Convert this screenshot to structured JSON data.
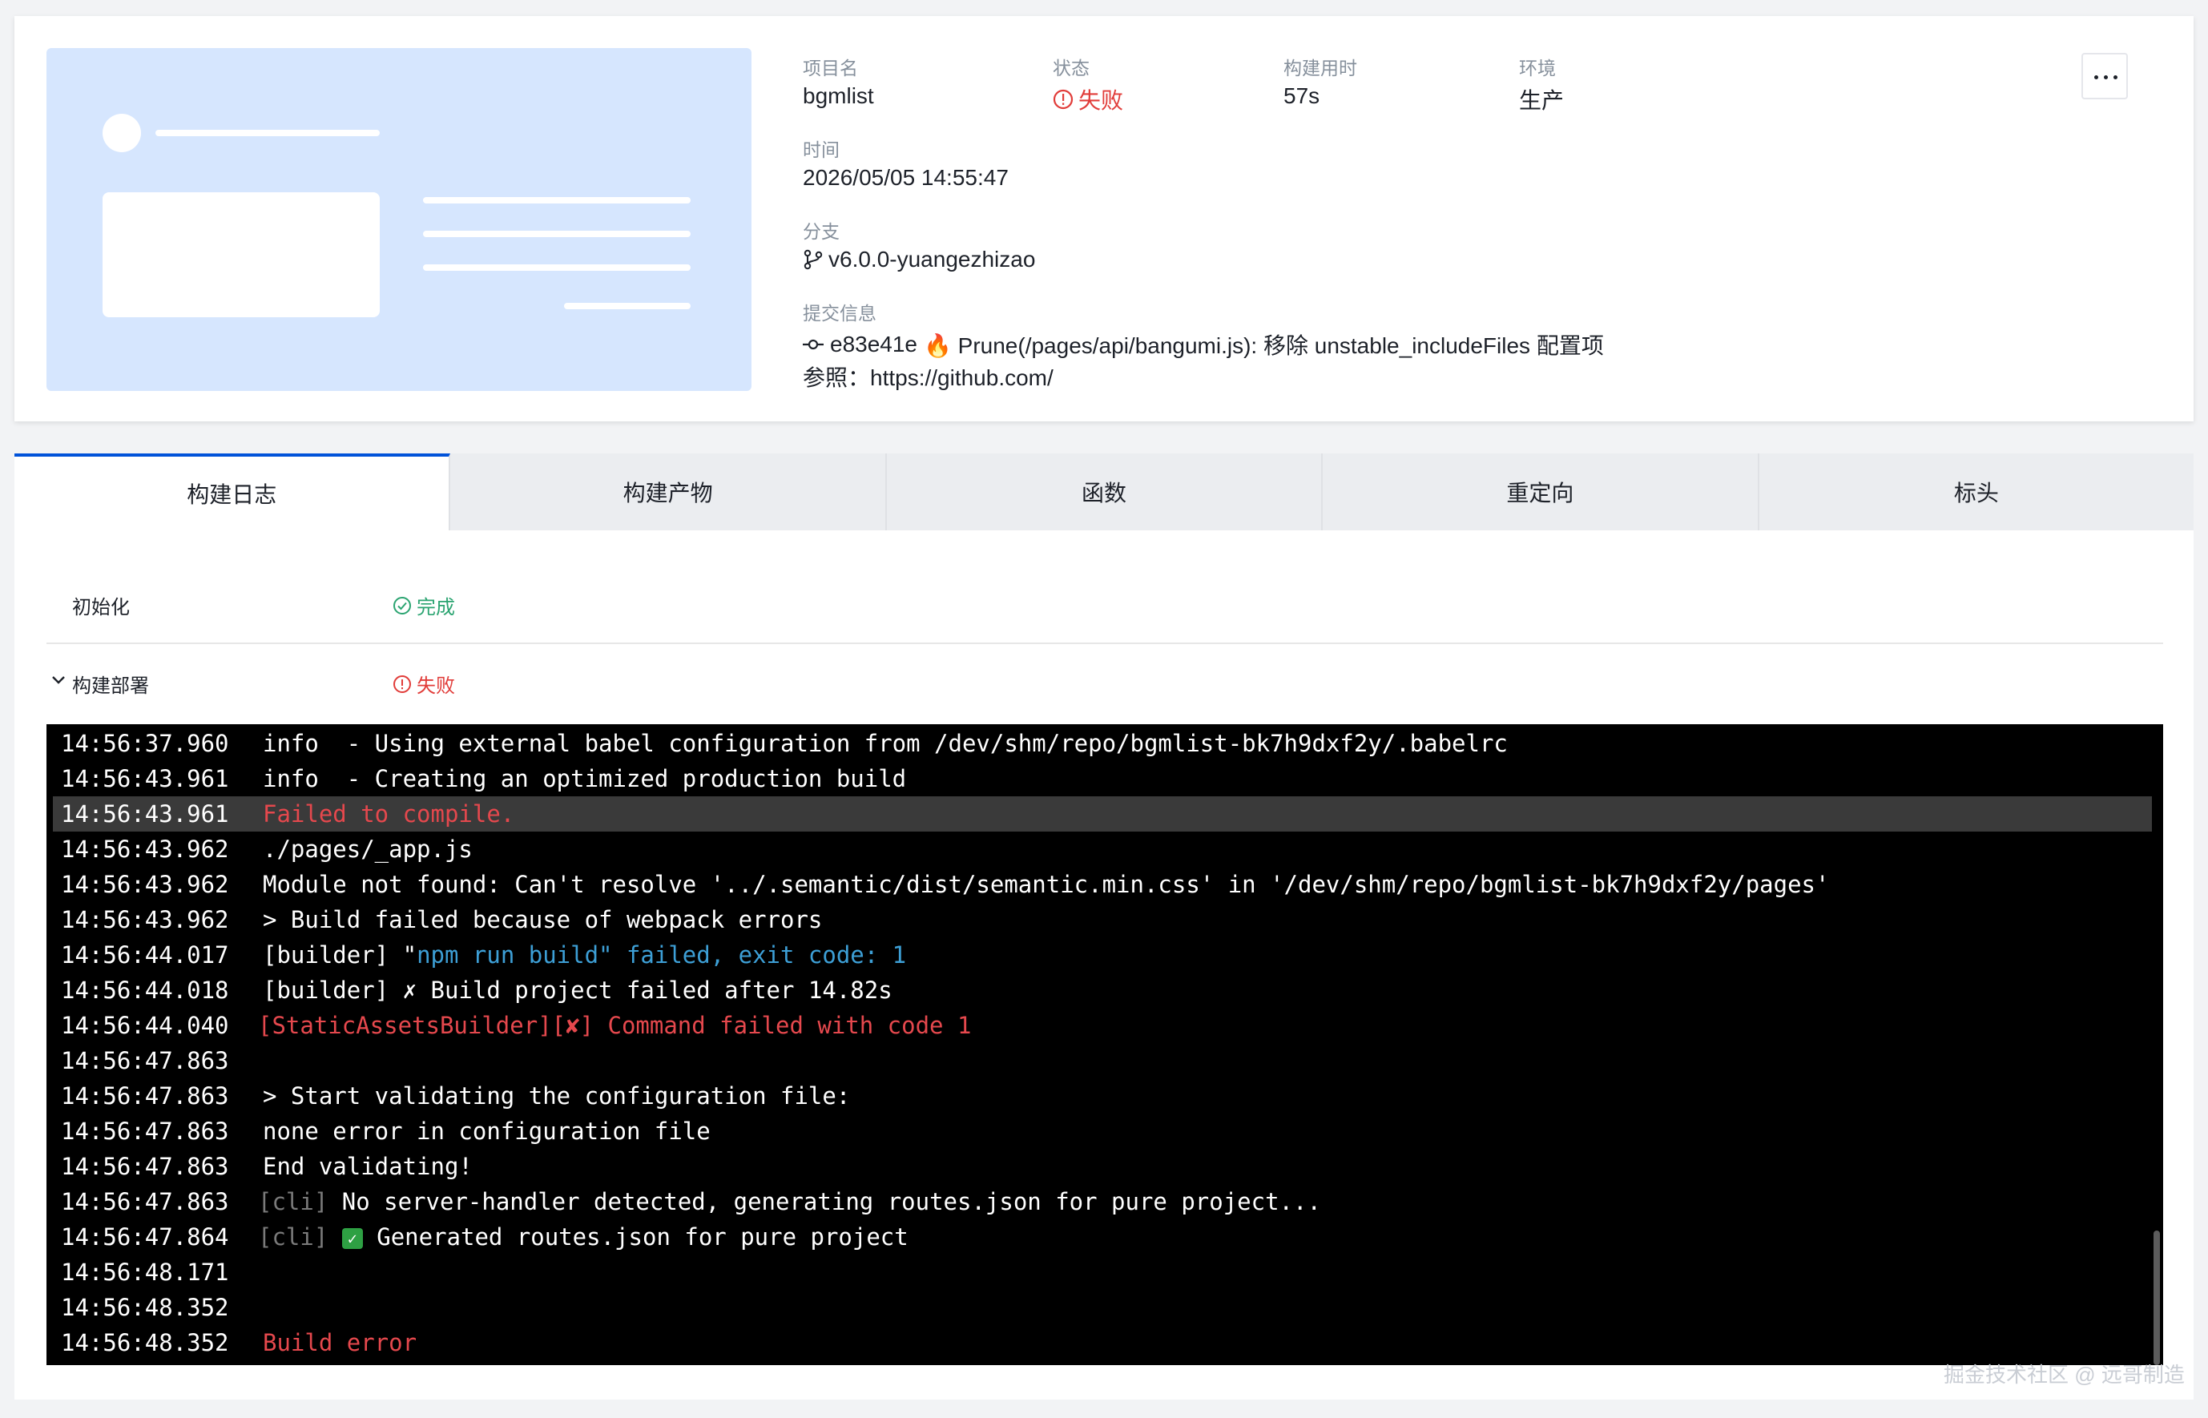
{
  "project": {
    "name_label": "项目名",
    "name": "bgmlist",
    "status_label": "状态",
    "status": "失败",
    "duration_label": "构建用时",
    "duration": "57s",
    "env_label": "环境",
    "env": "生产",
    "time_label": "时间",
    "time": "2026/05/05 14:55:47",
    "branch_label": "分支",
    "branch": "v6.0.0-yuangezhizao",
    "commit_label": "提交信息",
    "commit_hash": "e83e41e",
    "commit_message": "🔥 Prune(/pages/api/bangumi.js): 移除 unstable_includeFiles 配置项",
    "commit_ref": "参照：https://github.com/"
  },
  "tabs": [
    "构建日志",
    "构建产物",
    "函数",
    "重定向",
    "标头"
  ],
  "stages": [
    {
      "name": "初始化",
      "status": "完成"
    },
    {
      "name": "构建部署",
      "status": "失败"
    }
  ],
  "log": [
    {
      "ts": "14:56:37.960",
      "msg": "info  - Using external babel configuration from /dev/shm/repo/bgmlist-bk7h9dxf2y/.babelrc"
    },
    {
      "ts": "14:56:43.961",
      "msg": "info  - Creating an optimized production build"
    },
    {
      "ts": "14:56:43.961",
      "msg": "Failed to compile."
    },
    {
      "ts": "14:56:43.962",
      "msg": "./pages/_app.js"
    },
    {
      "ts": "14:56:43.962",
      "msg": "Module not found: Can't resolve '../.semantic/dist/semantic.min.css' in '/dev/shm/repo/bgmlist-bk7h9dxf2y/pages'"
    },
    {
      "ts": "14:56:43.962",
      "msg": "> Build failed because of webpack errors"
    },
    {
      "ts": "14:56:44.017",
      "msg_a": "[builder] \"",
      "msg_b": "npm run build\" failed, exit code: 1"
    },
    {
      "ts": "14:56:44.018",
      "msg": "[builder] ✗ Build project failed after 14.82s"
    },
    {
      "ts": "14:56:44.040",
      "msg": "[StaticAssetsBuilder][✘] Command failed with code 1"
    },
    {
      "ts": "14:56:47.863",
      "msg": ""
    },
    {
      "ts": "14:56:47.863",
      "msg": "> Start validating the configuration file:"
    },
    {
      "ts": "14:56:47.863",
      "msg": "none error in configuration file"
    },
    {
      "ts": "14:56:47.863",
      "msg": "End validating!"
    },
    {
      "ts": "14:56:47.863",
      "msg_a": "[cli]",
      "msg_b": " No server-handler detected, generating routes.json for pure project..."
    },
    {
      "ts": "14:56:47.864",
      "msg_a": "[cli]",
      "msg_b": "Generated routes.json for pure project"
    },
    {
      "ts": "14:56:48.171",
      "msg": ""
    },
    {
      "ts": "14:56:48.352",
      "msg": ""
    },
    {
      "ts": "14:56:48.352",
      "msg": "Build error"
    }
  ],
  "watermark": "掘金技术社区 @ 远哥制造",
  "colors": {
    "accent": "#0052d9",
    "error": "#e13c39",
    "success": "#2ba471"
  }
}
